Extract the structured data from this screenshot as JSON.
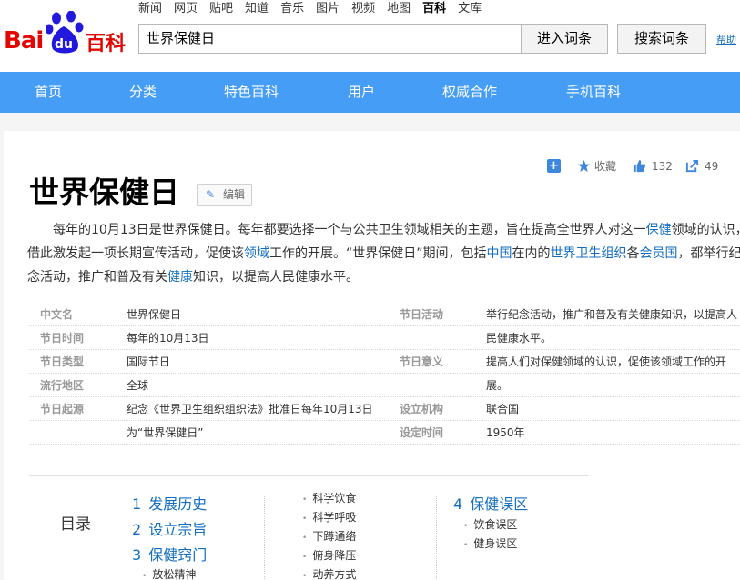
{
  "header": {
    "logo": {
      "bai": "Bai",
      "du": "du",
      "baike": "百科"
    },
    "topnav": [
      "新闻",
      "网页",
      "贴吧",
      "知道",
      "音乐",
      "图片",
      "视频",
      "地图",
      "百科",
      "文库"
    ],
    "active_topnav": "百科",
    "search_value": "世界保健日",
    "enter_button": "进入词条",
    "search_button": "搜索词条",
    "help_link": "帮助"
  },
  "mainnav": [
    "首页",
    "分类",
    "特色百科",
    "用户",
    "权威合作",
    "手机百科"
  ],
  "actions": {
    "favorite": "收藏",
    "likes": "132",
    "shares": "49"
  },
  "article": {
    "title": "世界保健日",
    "edit_label": "编辑",
    "summary": {
      "l1a": "每年的10月13日是世界保健日。每年都要选择一个与公共卫生领域相关的主题，旨在提高全世界人对这一",
      "l1link": "保健",
      "l1b": "领域的认识，",
      "l2a": "借此激发起一项长期宣传活动，促使该",
      "l2link1": "领域",
      "l2b": "工作的开展。“世界保健日”期间，包括",
      "l2link2": "中国",
      "l2c": "在内的",
      "l2link3": "世界卫生组织",
      "l2d": "各",
      "l2link4": "会员国",
      "l2e": "，都举行纪",
      "l3a": "念活动，推广和普及有关",
      "l3link": "健康",
      "l3b": "知识，以提高人民健康水平。"
    }
  },
  "info": {
    "left": [
      {
        "key": "中文名",
        "value": "世界保健日"
      },
      {
        "key": "节日时间",
        "value": "每年的10月13日"
      },
      {
        "key": "节日类型",
        "value": "国际节日"
      },
      {
        "key": "流行地区",
        "value": "全球"
      },
      {
        "key": "节日起源",
        "value": "纪念《世界卫生组织组织法》批准日每年10月13日"
      },
      {
        "key": "",
        "value": "为“世界保健日”"
      }
    ],
    "right": [
      {
        "key": "节日活动",
        "value": "举行纪念活动，推广和普及有关健康知识，以提高人"
      },
      {
        "key": "",
        "value": "民健康水平。"
      },
      {
        "key": "节日意义",
        "value": "提高人们对保健领域的认识，促使该领域工作的开"
      },
      {
        "key": "",
        "value": "展。"
      },
      {
        "key": "设立机构",
        "value": "联合国"
      },
      {
        "key": "设定时间",
        "value": "1950年"
      }
    ]
  },
  "catalog": {
    "title": "目录",
    "col1": [
      {
        "num": "1",
        "label": "发展历史"
      },
      {
        "num": "2",
        "label": "设立宗旨"
      },
      {
        "num": "3",
        "label": "保健窍门"
      }
    ],
    "col1_sub": [
      "放松精神"
    ],
    "col2_sub": [
      "科学饮食",
      "科学呼吸",
      "下蹲通络",
      "俯身降压",
      "动养方式"
    ],
    "col3": [
      {
        "num": "4",
        "label": "保健误区"
      }
    ],
    "col3_sub": [
      "饮食误区",
      "健身误区"
    ]
  }
}
